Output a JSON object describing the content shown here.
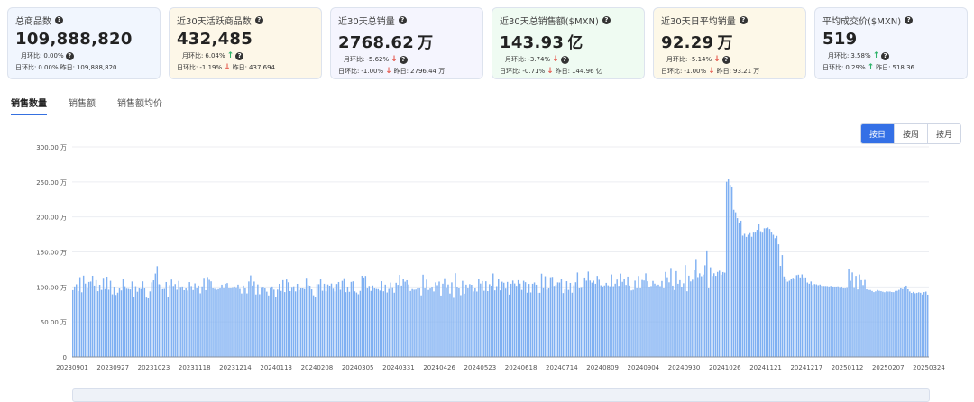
{
  "cards": [
    {
      "title": "总商品数",
      "value": "109,888,820",
      "unit": "",
      "l1_label": "月环比:",
      "l1_val": "0.00%",
      "l1_arrow": "",
      "l2_label": "日环比:",
      "l2_val": "0.00%",
      "l2_arrow": "",
      "l2_prev": "昨日:",
      "l2_prev_val": "109,888,820",
      "bg": "#f1f6fe"
    },
    {
      "title": "近30天活跃商品数",
      "value": "432,485",
      "unit": "",
      "l1_label": "月环比:",
      "l1_val": "6.04%",
      "l1_arrow": "↑",
      "l2_label": "日环比:",
      "l2_val": "-1.19%",
      "l2_arrow": "↓",
      "l2_prev": "昨日:",
      "l2_prev_val": "437,694",
      "bg": "#fdf7e8"
    },
    {
      "title": "近30天总销量",
      "value": "2768.62",
      "unit": "万",
      "l1_label": "月环比:",
      "l1_val": "-5.62%",
      "l1_arrow": "↓",
      "l2_label": "日环比:",
      "l2_val": "-1.00%",
      "l2_arrow": "↓",
      "l2_prev": "昨日:",
      "l2_prev_val": "2796.44 万",
      "bg": "#f5f5fe"
    },
    {
      "title": "近30天总销售额($MXN)",
      "value": "143.93",
      "unit": "亿",
      "l1_label": "月环比:",
      "l1_val": "-3.74%",
      "l1_arrow": "↓",
      "l2_label": "日环比:",
      "l2_val": "-0.71%",
      "l2_arrow": "↓",
      "l2_prev": "昨日:",
      "l2_prev_val": "144.96 亿",
      "bg": "#effbf2"
    },
    {
      "title": "近30天日平均销量",
      "value": "92.29",
      "unit": "万",
      "l1_label": "月环比:",
      "l1_val": "-5.14%",
      "l1_arrow": "↓",
      "l2_label": "日环比:",
      "l2_val": "-1.00%",
      "l2_arrow": "↓",
      "l2_prev": "昨日:",
      "l2_prev_val": "93.21 万",
      "bg": "#fdf8e8"
    },
    {
      "title": "平均成交价($MXN)",
      "value": "519",
      "unit": "",
      "l1_label": "月环比:",
      "l1_val": "3.58%",
      "l1_arrow": "↑",
      "l2_label": "日环比:",
      "l2_val": "0.29%",
      "l2_arrow": "↑",
      "l2_prev": "昨日:",
      "l2_prev_val": "518.36",
      "bg": "#f3f6fe"
    }
  ],
  "tabs": [
    "销售数量",
    "销售额",
    "销售额均价"
  ],
  "active_tab": 0,
  "granularity": [
    "按日",
    "按周",
    "按月"
  ],
  "active_granularity": 0,
  "colors": {
    "bar": "#7fb0f2",
    "accent": "#3470e6",
    "up": "#2fb36b",
    "down": "#e55a4f"
  },
  "chart_data": {
    "type": "bar",
    "ylim": [
      0,
      300
    ],
    "yticks": [
      0,
      50,
      100,
      150,
      200,
      250,
      300
    ],
    "ytick_labels": [
      "0",
      "50.00 万",
      "100.00 万",
      "150.00 万",
      "200.00 万",
      "250.00 万",
      "300.00 万"
    ],
    "x_first": "20230901",
    "x_last": "20250324",
    "xtick_labels": [
      "20230901",
      "20230927",
      "20231023",
      "20231118",
      "20231214",
      "20240113",
      "20240208",
      "20240305",
      "20240331",
      "20240426",
      "20240523",
      "20240618",
      "20240714",
      "20240809",
      "20240904",
      "20240930",
      "20241026",
      "20241121",
      "20241217",
      "20250112",
      "20250207",
      "20250324"
    ],
    "unit": "万",
    "values": [
      95.4,
      100.6,
      103.7,
      94.0,
      113.9,
      92.3,
      116.1,
      104.6,
      98.2,
      107.0,
      107.6,
      115.9,
      101.8,
      109.6,
      93.9,
      103.0,
      95.7,
      113.0,
      96.9,
      114.6,
      96.0,
      108.7,
      89.4,
      100.4,
      88.5,
      91.7,
      98.6,
      95.0,
      110.8,
      100.9,
      97.5,
      97.1,
      96.4,
      107.7,
      85.1,
      101.0,
      93.1,
      97.9,
      97.0,
      107.9,
      98.4,
      84.8,
      83.7,
      93.6,
      106.4,
      109.4,
      119.0,
      129.6,
      103.7,
      103.3,
      96.8,
      97.2,
      106.9,
      85.9,
      102.5,
      110.5,
      101.3,
      104.0,
      96.0,
      108.5,
      100.1,
      100.6,
      95.3,
      98.1,
      94.8,
      106.8,
      101.2,
      95.5,
      104.9,
      98.9,
      101.9,
      90.8,
      100.7,
      113.0,
      95.3,
      114.1,
      110.1,
      107.9,
      98.6,
      97.3,
      95.8,
      96.8,
      97.8,
      103.1,
      99.2,
      104.4,
      105.4,
      98.9,
      98.5,
      99.7,
      100.6,
      99.5,
      103.2,
      97.1,
      90.6,
      101.9,
      99.0,
      90.7,
      107.7,
      116.4,
      101.9,
      107.6,
      89.2,
      103.5,
      89.5,
      99.8,
      100.2,
      98.5,
      93.2,
      87.8,
      99.6,
      100.6,
      96.1,
      85.2,
      96.2,
      104.3,
      94.3,
      109.6,
      92.6,
      110.6,
      106.5,
      94.0,
      100.0,
      100.8,
      93.6,
      104.3,
      95.5,
      98.8,
      98.0,
      96.9,
      113.0,
      102.5,
      101.7,
      96.5,
      88.0,
      85.9,
      103.9,
      103.8,
      110.7,
      94.5,
      104.4,
      93.8,
      103.4,
      101.7,
      104.7,
      97.5,
      93.5,
      104.1,
      106.9,
      95.9,
      108.6,
      112.4,
      92.5,
      100.4,
      93.0,
      107.1,
      107.9,
      93.7,
      91.9,
      89.5,
      94.3,
      115.9,
      113.5,
      115.7,
      97.8,
      101.4,
      94.3,
      102.0,
      99.1,
      97.1,
      96.8,
      94.8,
      108.1,
      93.8,
      103.2,
      92.0,
      97.2,
      106.1,
      99.6,
      91.7,
      105.8,
      102.9,
      117.1,
      101.9,
      111.7,
      107.4,
      109.5,
      103.4,
      94.2,
      96.9,
      96.0,
      96.3,
      98.2,
      99.2,
      87.9,
      117.4,
      97.8,
      110.4,
      95.6,
      97.7,
      100.3,
      93.5,
      106.4,
      102.4,
      107.6,
      87.7,
      104.5,
      112.4,
      99.5,
      103.4,
      90.5,
      106.4,
      84.4,
      119.5,
      100.4,
      98.4,
      88.2,
      108.6,
      90.3,
      103.2,
      98.8,
      103.9,
      103.0,
      93.5,
      98.9,
      93.4,
      111.0,
      104.7,
      108.3,
      94.5,
      108.0,
      94.0,
      103.8,
      101.7,
      119.1,
      95.1,
      101.1,
      110.8,
      95.1,
      107.4,
      105.9,
      97.6,
      107.1,
      89.0,
      104.4,
      109.0,
      104.8,
      101.5,
      109.6,
      104.6,
      95.7,
      108.7,
      106.7,
      91.7,
      104.2,
      92.1,
      104.4,
      106.3,
      103.1,
      91.5,
      91.6,
      118.8,
      99.3,
      115.2,
      96.1,
      98.4,
      113.8,
      114.3,
      101.4,
      102.6,
      106.4,
      106.2,
      111.0,
      91.2,
      96.4,
      108.1,
      95.7,
      105.6,
      91.7,
      102.2,
      106.6,
      120.5,
      98.7,
      99.8,
      100.0,
      113.4,
      108.9,
      121.8,
      109.1,
      106.1,
      108.9,
      104.4,
      115.7,
      110.2,
      102.3,
      100.6,
      102.0,
      105.7,
      102.2,
      100.9,
      117.7,
      101.0,
      104.5,
      110.5,
      101.5,
      118.9,
      107.2,
      111.4,
      102.8,
      114.7,
      101.9,
      95.0,
      95.8,
      108.9,
      98.9,
      115.6,
      97.9,
      109.9,
      109.2,
      119.3,
      108.0,
      100.4,
      101.2,
      108.5,
      104.6,
      102.1,
      103.2,
      101.1,
      108.4,
      98.7,
      121.3,
      113.8,
      106.5,
      127.0,
      101.8,
      95.5,
      122.5,
      104.4,
      109.6,
      100.4,
      105.1,
      131.1,
      93.8,
      116.0,
      107.8,
      110.3,
      123.8,
      139.8,
      114.0,
      119.3,
      115.2,
      117.5,
      130.8,
      152.1,
      98.7,
      128.0,
      115.6,
      119.4,
      115.8,
      121.3,
      123.1,
      117.4,
      121.1,
      120.3,
      250.2,
      253.6,
      245.7,
      243.4,
      210.2,
      206.5,
      198.2,
      191.9,
      194.5,
      173.2,
      175.8,
      171.4,
      174.5,
      178.1,
      171.6,
      178.8,
      178.9,
      181.5,
      189.5,
      179.5,
      178.7,
      183.7,
      183.8,
      184.9,
      182.7,
      178.9,
      174.4,
      169.6,
      172.8,
      160.8,
      130.0,
      145.4,
      114.9,
      110.9,
      107.4,
      108.8,
      112.0,
      113.0,
      111.1,
      116.7,
      117.4,
      113.5,
      117.8,
      113.5,
      113.5,
      106.2,
      104.5,
      107.7,
      102.7,
      104.0,
      103.6,
      102.4,
      103.3,
      101.8,
      101.4,
      101.3,
      101.2,
      100.6,
      101.4,
      100.5,
      100.5,
      100.5,
      100.8,
      99.8,
      100.5,
      99.1,
      97.8,
      99.7,
      126.2,
      108.7,
      120.6,
      99.7,
      115.7,
      96.4,
      117.7,
      109.6,
      102.6,
      109.9,
      96.5,
      95.6,
      95.6,
      94.2,
      92.6,
      93.7,
      95.6,
      94.4,
      93.9,
      93.1,
      92.4,
      93.6,
      93.3,
      93.4,
      92.7,
      92.5,
      94.3,
      94.4,
      95.8,
      97.9,
      96.9,
      100.5,
      101.8,
      96.6,
      93.5,
      91.4,
      92.9,
      90.9,
      91.5,
      92.3,
      91.6,
      89.1,
      92.6,
      93.3,
      88.9
    ]
  }
}
